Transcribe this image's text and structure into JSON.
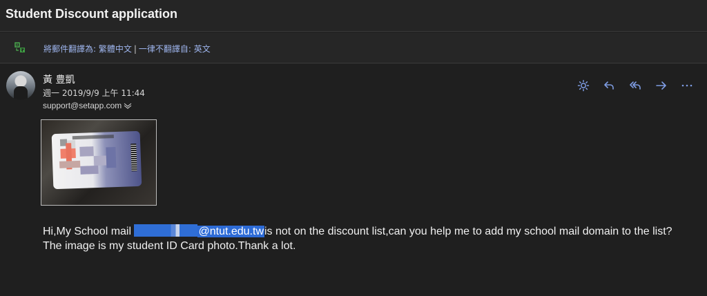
{
  "header": {
    "subject": "Student Discount application"
  },
  "translation": {
    "translate_link": "將郵件翻譯為: 繁體中文",
    "separator": "|",
    "never_translate_link": "一律不翻譯自: 英文"
  },
  "message": {
    "sender_name": "黃 豊凱",
    "date": "週一 2019/9/9 上午 11:44",
    "recipient": "support@setapp.com",
    "body": {
      "greeting_before": "Hi,My School mail ",
      "email_domain": "@ntut.edu.tw",
      "greeting_after": "is not on the discount list,can you help me to add my school mail domain to the list?",
      "line2": "The image is my student ID Card photo.Thank a lot."
    }
  },
  "actions": {
    "icons": [
      "sun-icon",
      "reply-icon",
      "reply-all-icon",
      "forward-icon",
      "more-icon"
    ]
  },
  "colors": {
    "background": "#1f1f1f",
    "accent": "#7f9de4",
    "highlight": "#2d6bd6"
  }
}
